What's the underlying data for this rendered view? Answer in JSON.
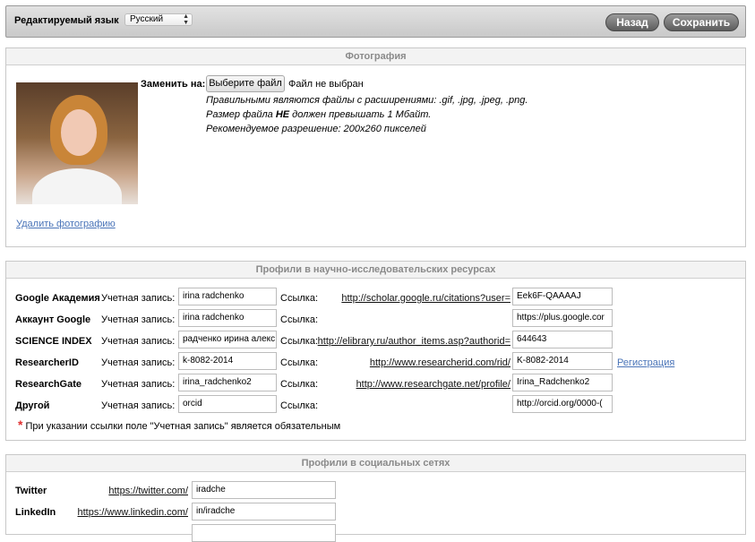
{
  "toolbar": {
    "lang_label": "Редактируемый язык",
    "lang_value": "Русский",
    "back_label": "Назад",
    "save_label": "Сохранить"
  },
  "photo_section": {
    "title": "Фотография",
    "replace_label": "Заменить на:",
    "file_button": "Выберите файл",
    "file_status": "Файл не выбран",
    "hint_formats_prefix": "Правильными являются файлы с расширениями: .gif, .jpg, .jpeg, .png.",
    "hint_size_a": "Размер файла ",
    "hint_size_b": "НЕ",
    "hint_size_c": " должен превышать 1 Мбайт.",
    "hint_resolution": "Рекомендуемое разрешение: 200x260 пикселей",
    "delete_link": "Удалить фотографию"
  },
  "profiles_section": {
    "title": "Профили в научно-исследовательских ресурсах",
    "account_label": "Учетная запись:",
    "link_label": "Ссылка:",
    "register_link": "Регистрация",
    "required_note": "При указании ссылки поле \"Учетная запись\" является обязательным",
    "rows": [
      {
        "name": "Google Академия",
        "account": "irina radchenko",
        "url": "http://scholar.google.ru/citations?user=",
        "link_value": "Eek6F-QAAAAJ"
      },
      {
        "name": "Аккаунт Google",
        "account": "irina radchenko",
        "url": "",
        "link_value": "https://plus.google.cor"
      },
      {
        "name": "SCIENCE INDEX",
        "account": "радченко ирина алекс",
        "url": "http://elibrary.ru/author_items.asp?authorid=",
        "link_value": "644643"
      },
      {
        "name": "ResearcherID",
        "account": "k-8082-2014",
        "url": "http://www.researcherid.com/rid/",
        "link_value": "K-8082-2014"
      },
      {
        "name": "ResearchGate",
        "account": "irina_radchenko2",
        "url": "http://www.researchgate.net/profile/",
        "link_value": "Irina_Radchenko2"
      },
      {
        "name": "Другой",
        "account": "orcid",
        "url": "",
        "link_value": "http://orcid.org/0000-("
      }
    ]
  },
  "social_section": {
    "title": "Профили в социальных сетях",
    "rows": [
      {
        "name": "Twitter",
        "url": "https://twitter.com/",
        "value": "iradche"
      },
      {
        "name": "LinkedIn",
        "url": "https://www.linkedin.com/",
        "value": "in/iradche"
      }
    ]
  }
}
